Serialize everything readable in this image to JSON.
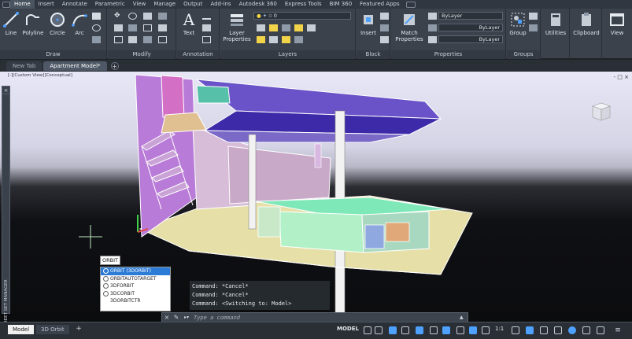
{
  "ribbon_tabs": [
    "Home",
    "Insert",
    "Annotate",
    "Parametric",
    "View",
    "Manage",
    "Output",
    "Add-ins",
    "Autodesk 360",
    "Express Tools",
    "BIM 360",
    "Featured Apps"
  ],
  "draw": {
    "title": "Draw",
    "line": "Line",
    "polyline": "Polyline",
    "circle": "Circle",
    "arc": "Arc"
  },
  "modify": {
    "title": "Modify"
  },
  "annotation": {
    "title": "Annotation",
    "text": "Text"
  },
  "layers": {
    "title": "Layers",
    "layer_properties": "Layer Properties",
    "current_layer": "0"
  },
  "block": {
    "title": "Block",
    "insert": "Insert"
  },
  "properties": {
    "title": "Properties",
    "match": "Match Properties",
    "color": "ByLayer",
    "linetype": "ByLayer",
    "lineweight": "ByLayer"
  },
  "groups": {
    "title": "Groups",
    "group": "Group"
  },
  "utilities": {
    "label": "Utilities"
  },
  "clipboard": {
    "label": "Clipboard"
  },
  "view": {
    "label": "View"
  },
  "file_tabs": [
    "New Tab",
    "Apartment Model*"
  ],
  "viewport": {
    "label": "[-][Custom View][Conceptual]",
    "controls": "-  □  ×"
  },
  "palette": {
    "label": "SHEET SET MANAGER"
  },
  "autocomplete": {
    "typed": "ORBIT",
    "items": [
      "ORBIT (3DORBIT)",
      "ORBITAUTOTARGET",
      "3DFORBIT",
      "3DCORBIT",
      "3DORBITCTR"
    ]
  },
  "history": [
    "Command: *Cancel*",
    "Command: *Cancel*",
    "Command:   <Switching to: Model>"
  ],
  "command": {
    "placeholder": "Type a command"
  },
  "layout_tabs": [
    "Model",
    "3D Orbit"
  ],
  "status": {
    "space": "MODEL",
    "scale": "1:1"
  },
  "colors": {
    "ribbon": "#3b424c",
    "accent": "#2c7bd6",
    "tab_bar": "#313740"
  }
}
